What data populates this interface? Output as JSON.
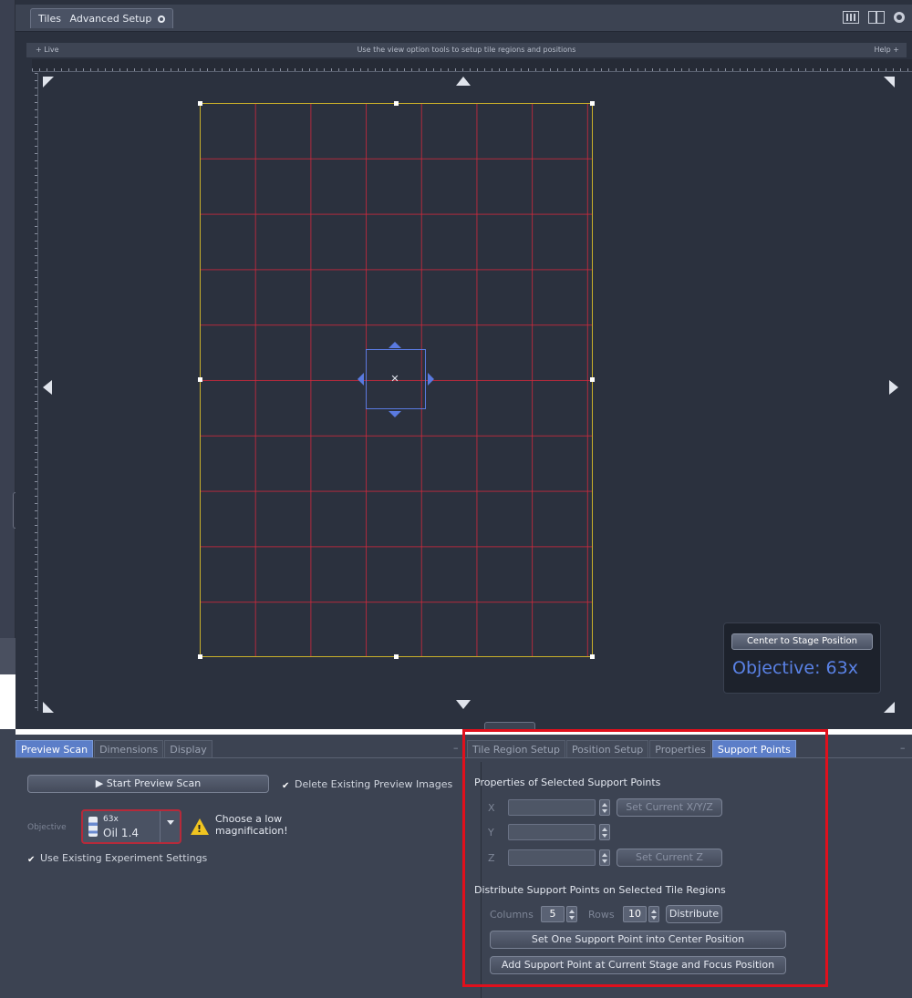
{
  "viewer": {
    "title_prefix": "Tiles",
    "title": "Advanced Setup",
    "info_left": "+ Live",
    "info_center": "Use the view option tools to setup tile regions and positions",
    "info_right": "Help +",
    "center_button": "Center to Stage Position",
    "objective_display": "Objective:  63x"
  },
  "left_panel": {
    "tabs": [
      "Preview Scan",
      "Dimensions",
      "Display"
    ],
    "active_tab": 0,
    "start_button": "▶  Start Preview Scan",
    "delete_checkbox": "Delete Existing Preview Images",
    "delete_checked": true,
    "objective_label": "Objective",
    "objective_mag": "63x",
    "objective_name": "Oil 1.4",
    "warning": "Choose a low magnification!",
    "use_existing": "Use Existing Experiment Settings",
    "use_existing_checked": true
  },
  "right_panel": {
    "tabs": [
      "Tile Region Setup",
      "Position Setup",
      "Properties",
      "Support Points"
    ],
    "active_tab": 3,
    "section1": "Properties of Selected Support Points",
    "x_label": "X",
    "y_label": "Y",
    "z_label": "Z",
    "set_xyz": "Set Current X/Y/Z",
    "set_z": "Set Current Z",
    "section2": "Distribute Support Points on Selected Tile Regions",
    "columns_label": "Columns",
    "columns_value": "5",
    "rows_label": "Rows",
    "rows_value": "10",
    "distribute": "Distribute",
    "set_center": "Set One Support Point into Center Position",
    "add_point": "Add Support Point at Current Stage and Focus Position"
  },
  "colors": {
    "accent": "#5c7ec8",
    "tile_border": "#c9b02a",
    "grid_lines": "#d2283c",
    "stage_marker": "#5a7ae0",
    "highlight": "#e0101c",
    "warning": "#f0c420"
  }
}
